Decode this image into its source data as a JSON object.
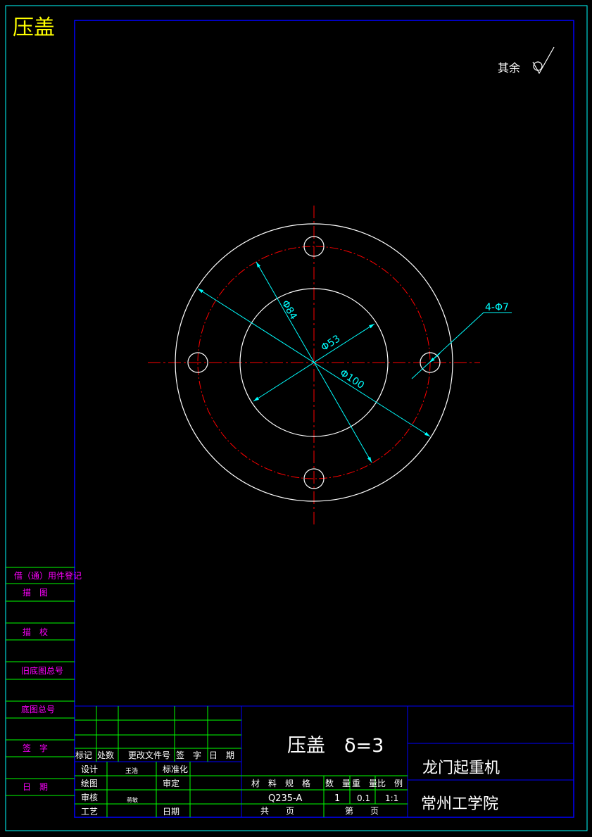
{
  "title_corner": "压盖",
  "roughness_note": "其余",
  "dimensions": {
    "d84": "Φ84",
    "d53": "Φ53",
    "d100": "Φ100",
    "holes": "4-Φ7"
  },
  "left_column": [
    "借（通）用件登记",
    "描　图",
    "描　校",
    "旧底图总号",
    "底图总号",
    "签　字",
    "日　期"
  ],
  "revision_headers": [
    "标记",
    "处数",
    "更改文件号",
    "签　字",
    "日　期"
  ],
  "approval": {
    "design": "设计",
    "design_name": "王浩",
    "standard": "标准化",
    "drawing": "绘图",
    "review": "审定",
    "check": "审核",
    "check_name": "蒋敏",
    "process": "工艺",
    "date": "日期"
  },
  "part_title": "压盖　δ=3",
  "material_header": "材　料　规　格",
  "qty_header": "数　量",
  "weight_header": "重　量",
  "scale_header": "比　例",
  "material": "Q235-A",
  "qty": "1",
  "weight": "0.1",
  "scale": "1:1",
  "total_pages": "共　　页",
  "page_no": "第　　页",
  "project": "龙门起重机",
  "school": "常州工学院",
  "colors": {
    "frame": "#0000ff",
    "outer_border": "#00ffff",
    "grid": "#00ff00",
    "center_line": "#ff0000",
    "geometry": "#ffffff",
    "dimension": "#00ffff",
    "label": "#ff00ff",
    "corner_title": "#ffff00"
  }
}
